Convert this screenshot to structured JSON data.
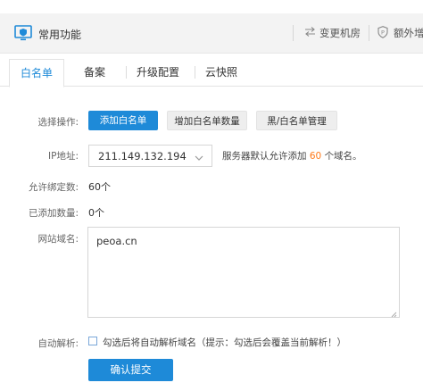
{
  "header": {
    "title": "常用功能",
    "switch_room": "变更机房",
    "extra": "额外增",
    "icons": {
      "app": "monitor-shield-icon",
      "switch": "swap-arrows-icon",
      "extra": "shield-p-icon"
    }
  },
  "tabs": [
    {
      "label": "白名单",
      "active": true
    },
    {
      "label": "备案",
      "active": false
    },
    {
      "label": "升级配置",
      "active": false
    },
    {
      "label": "云快照",
      "active": false
    }
  ],
  "form": {
    "operation": {
      "label": "选择操作:",
      "buttons": [
        "添加白名单",
        "增加白名单数量",
        "黑/白名单管理"
      ]
    },
    "ip": {
      "label": "IP地址:",
      "selected": "211.149.132.194",
      "note_before": "服务器默认允许添加",
      "note_number": "60",
      "note_after": "个域名。"
    },
    "allowed": {
      "label": "允许绑定数:",
      "value": "60个"
    },
    "added": {
      "label": "已添加数量:",
      "value": "0个"
    },
    "domain": {
      "label": "网站域名:",
      "value": "peoa.cn"
    },
    "auto_resolve": {
      "label": "自动解析:",
      "checkbox_text": "勾选后将自动解析域名（提示：勾选后会覆盖当前解析！）",
      "checked": false
    },
    "submit": "确认提交"
  },
  "colors": {
    "accent": "#1e8ad8",
    "highlight": "#ff7a1a"
  }
}
